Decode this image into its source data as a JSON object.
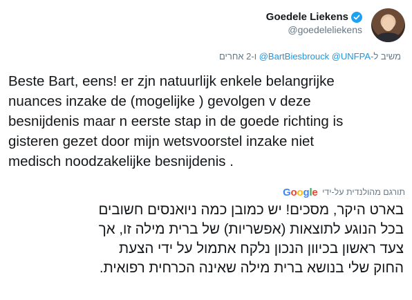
{
  "author": {
    "display_name": "Goedele Liekens",
    "handle": "@goedeleliekens",
    "avatar_icon": "profile-photo",
    "verified_icon": "verified-badge-icon",
    "verified_color": "#1da1f2"
  },
  "reply_context": {
    "prefix": "משיב ל-",
    "mentions": "@BartBiesbrouck @UNFPA",
    "suffix": "ו-2 אחרים"
  },
  "tweet": {
    "lines": [
      "Beste Bart,  eens! er zjn natuurlijk enkele belangrijke",
      "nuances inzake de (mogelijke ) gevolgen v deze",
      "besnijdenis maar n eerste stap in de goede richting is",
      "gisteren gezet door mijn wetsvoorstel inzake niet",
      "medisch noodzakelijke besnijdenis ."
    ]
  },
  "translation": {
    "label": "תורגם מהולנדית על-ידי",
    "provider": "Google",
    "lines": [
      "בארט היקר, מסכים! יש כמובן כמה ניואנסים חשובים",
      "בכל הנוגע לתוצאות (אפשריות) של ברית מילה זו, אך",
      "צעד ראשון בכיוון הנכון נלקח אתמול על ידי הצעת",
      "החוק שלי בנושא ברית מילה שאינה הכרחית רפואית."
    ]
  },
  "colors": {
    "text": "#14171a",
    "secondary": "#657786",
    "link": "#1b95e0"
  }
}
